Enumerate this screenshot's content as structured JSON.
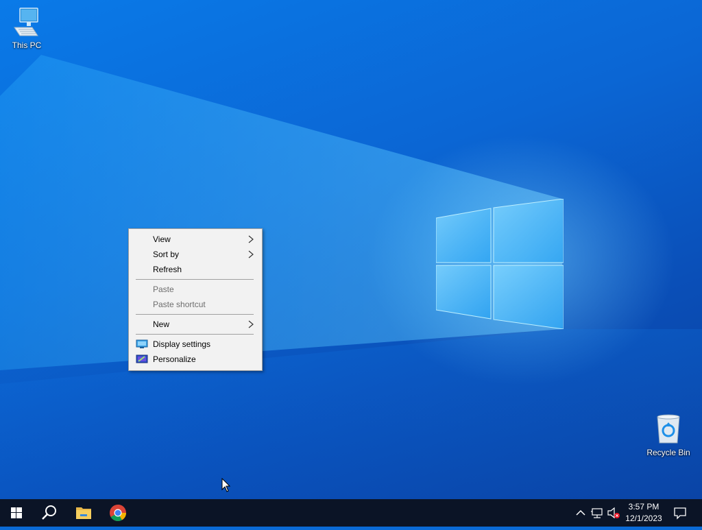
{
  "desktop": {
    "icons": [
      {
        "label": "This PC",
        "icon": "computer-icon"
      },
      {
        "label": "Recycle Bin",
        "icon": "recycle-bin-icon"
      }
    ]
  },
  "context_menu": {
    "items": [
      {
        "label": "View",
        "enabled": true,
        "submenu": true
      },
      {
        "label": "Sort by",
        "enabled": true,
        "submenu": true
      },
      {
        "label": "Refresh",
        "enabled": true
      },
      {
        "label": "Paste",
        "enabled": false
      },
      {
        "label": "Paste shortcut",
        "enabled": false
      },
      {
        "label": "New",
        "enabled": true,
        "submenu": true
      },
      {
        "label": "Display settings",
        "enabled": true,
        "icon": "display-icon"
      },
      {
        "label": "Personalize",
        "enabled": true,
        "icon": "personalize-icon"
      }
    ]
  },
  "taskbar": {
    "pinned": [
      {
        "name": "Start",
        "icon": "windows-logo-icon"
      },
      {
        "name": "Search",
        "icon": "search-icon"
      },
      {
        "name": "File Explorer",
        "icon": "folder-icon"
      },
      {
        "name": "Google Chrome",
        "icon": "chrome-icon"
      }
    ],
    "tray": {
      "icons": [
        "chevron-up-icon",
        "network-icon",
        "volume-muted-icon",
        "notification-icon"
      ],
      "time": "3:57 PM",
      "date": "12/1/2023"
    }
  },
  "colors": {
    "wallpaper": "#0a6ad6",
    "taskbar": "#0b1426",
    "menu_background": "#f2f2f2",
    "menu_disabled_text": "#6d6d6d"
  }
}
